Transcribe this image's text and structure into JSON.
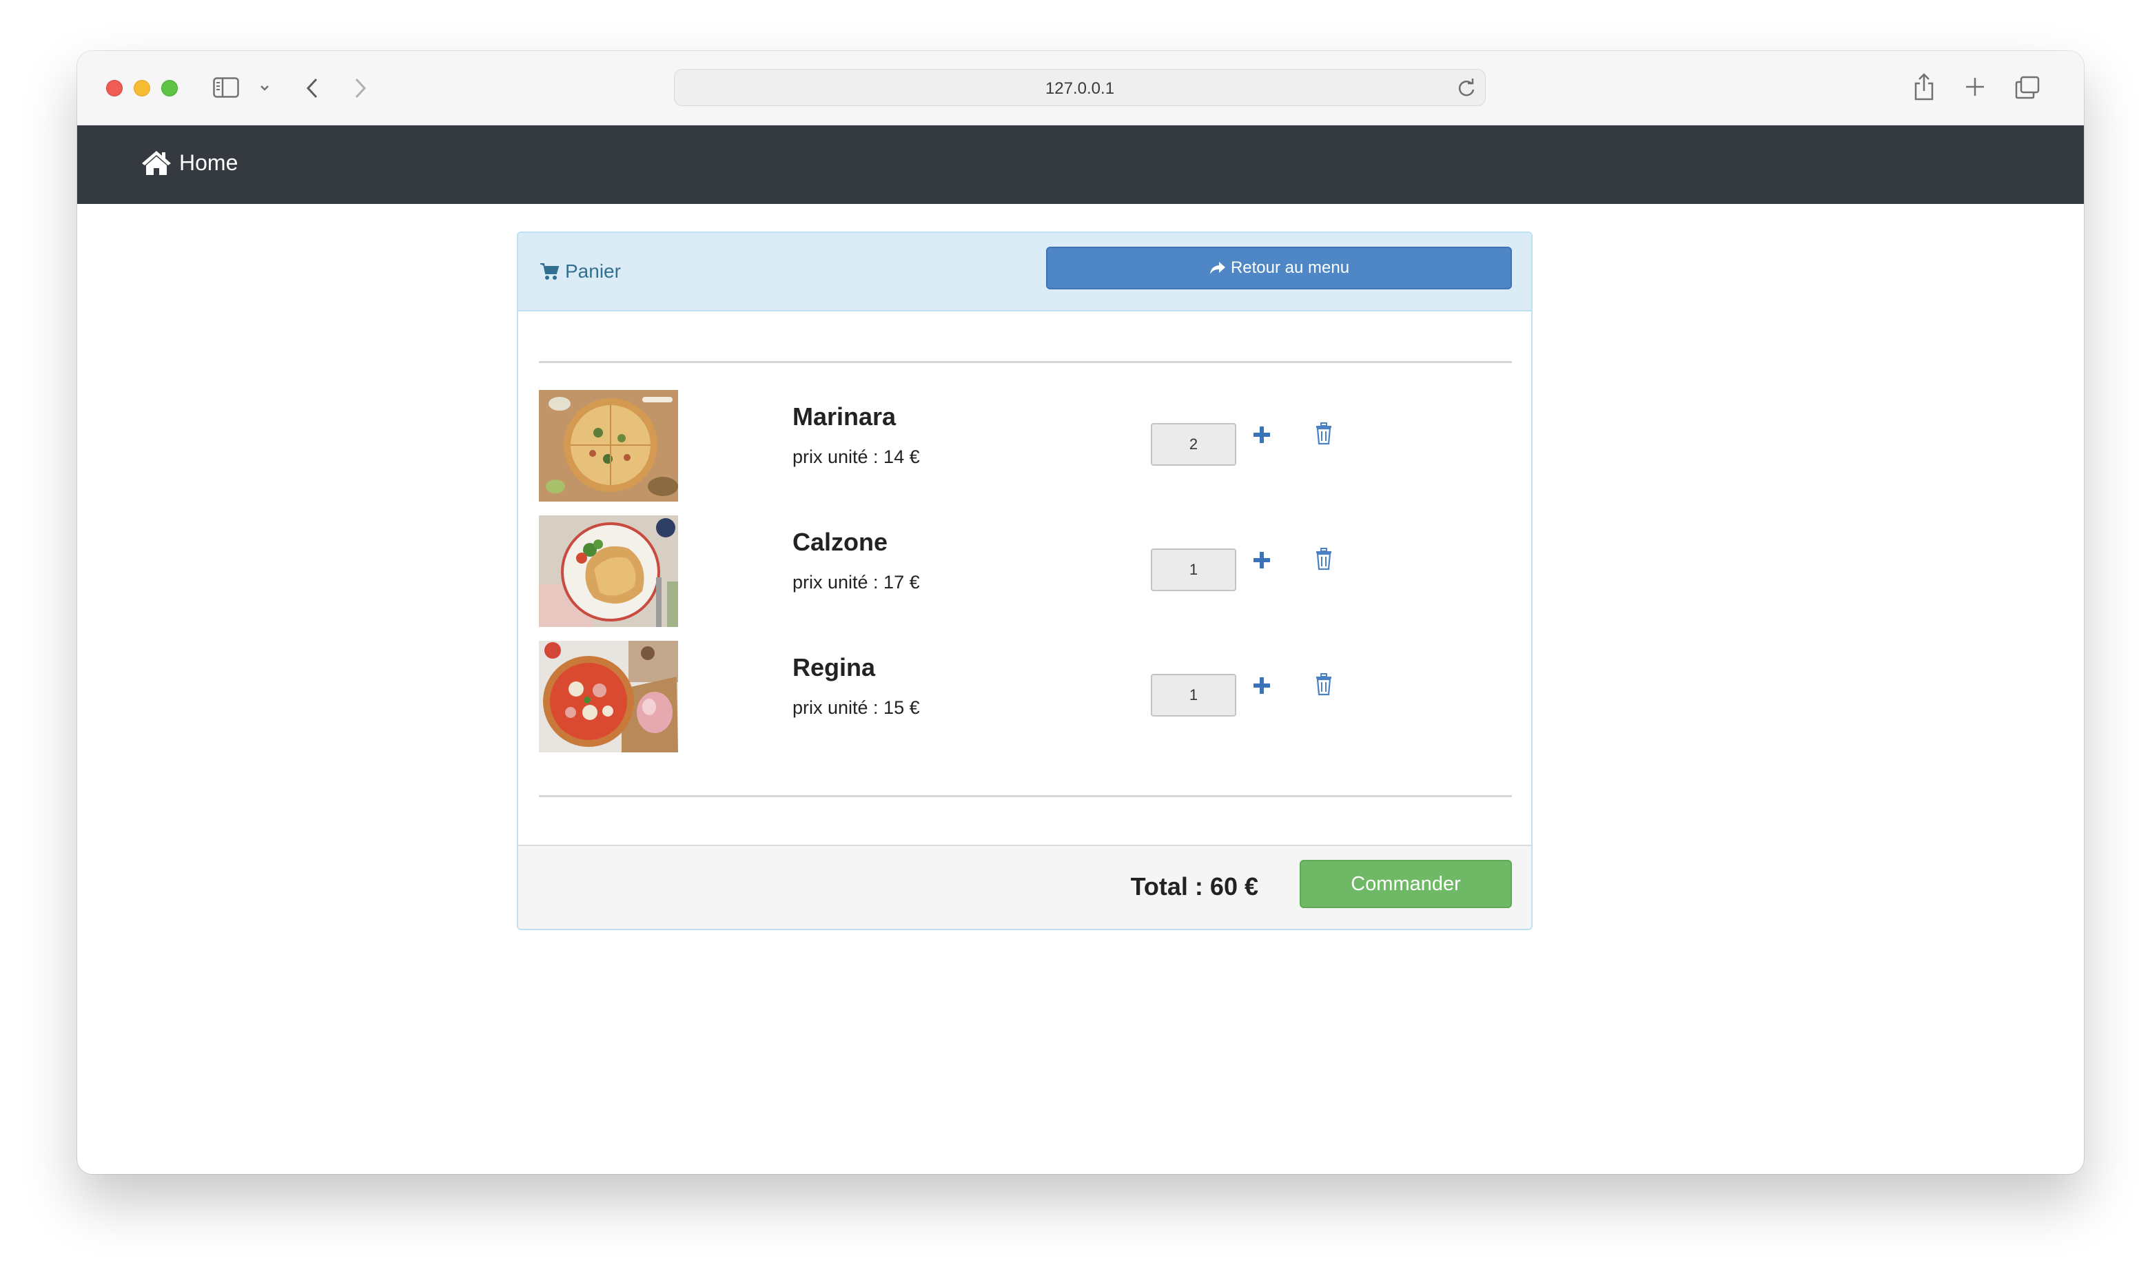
{
  "browser": {
    "url": "127.0.0.1"
  },
  "navbar": {
    "brand_label": "Home"
  },
  "cart": {
    "title": "Panier",
    "back_button_label": "Retour au menu",
    "items": [
      {
        "name": "Marinara",
        "unit_price_label": "prix unité : 14 €",
        "quantity": "2",
        "image": "pizza-marinara-photo"
      },
      {
        "name": "Calzone",
        "unit_price_label": "prix unité : 17 €",
        "quantity": "1",
        "image": "calzone-photo"
      },
      {
        "name": "Regina",
        "unit_price_label": "prix unité : 15 €",
        "quantity": "1",
        "image": "pizza-regina-photo"
      }
    ],
    "total_label": "Total : 60 €",
    "order_button_label": "Commander"
  },
  "icons": [
    "sidebar-icon",
    "chevron-down-icon",
    "back-arrow-icon",
    "forward-arrow-icon",
    "reload-icon",
    "share-icon",
    "new-tab-icon",
    "tabs-overview-icon",
    "home-icon",
    "cart-icon",
    "share-arrow-icon",
    "plus-icon",
    "trash-icon"
  ],
  "colors": {
    "navbar": "#343a40",
    "panel_heading": "#dcecf7",
    "panel_title": "#31708f",
    "primary_button": "#4f86c6",
    "success_button": "#6fb865",
    "icon_blue": "#3a73b8"
  }
}
